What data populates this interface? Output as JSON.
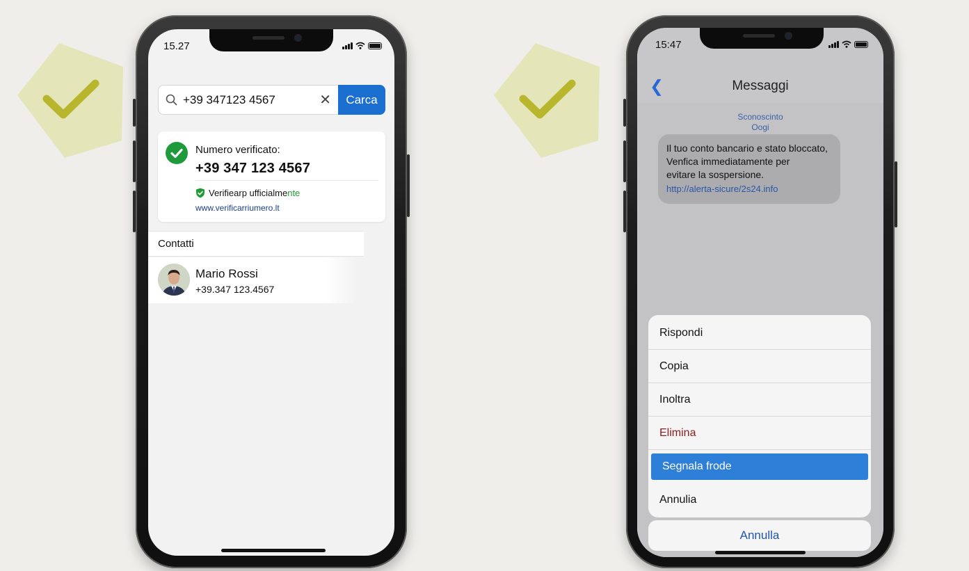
{
  "left_phone": {
    "status_time": "15.27",
    "search": {
      "query": "+39 347123 4567",
      "button_label": "Carca"
    },
    "verification": {
      "label": "Numero verificato:",
      "number": "+39 347 123 4567",
      "official_text": "Verifiearp ufficialme",
      "official_text_highlight": "nte",
      "url": "www.verificarriumero.lt"
    },
    "contacts": {
      "header": "Contatti",
      "items": [
        {
          "name": "Mario Rossi",
          "phone": "+39.347 123.4567"
        }
      ]
    }
  },
  "right_phone": {
    "status_time": "15:47",
    "header_title": "Messaggi",
    "sender_name": "Sconoscinto",
    "sender_date": "Oogi",
    "message": {
      "line1": "Il tuo conto bancario e stato bloccato,",
      "line2": "Venfica immediatamente per",
      "line3": "evitare la sospersione.",
      "link": "http://alerta-sicure/2s24.info"
    },
    "action_sheet": {
      "items": [
        {
          "label": "Rispondi"
        },
        {
          "label": "Copia"
        },
        {
          "label": "Inoltra"
        },
        {
          "label": "Elimina"
        },
        {
          "label": "Segnala frode"
        },
        {
          "label": "Annulia"
        }
      ],
      "cancel_label": "Annulla"
    }
  },
  "colors": {
    "background": "#efeeeb",
    "pentagon": "#e4e5b8",
    "checkmark": "#b7b62d",
    "primary_blue": "#1b6fd1",
    "verified_green": "#1f9a3a",
    "danger_red": "#8a1c1c",
    "selected_blue": "#2e7fd8"
  }
}
